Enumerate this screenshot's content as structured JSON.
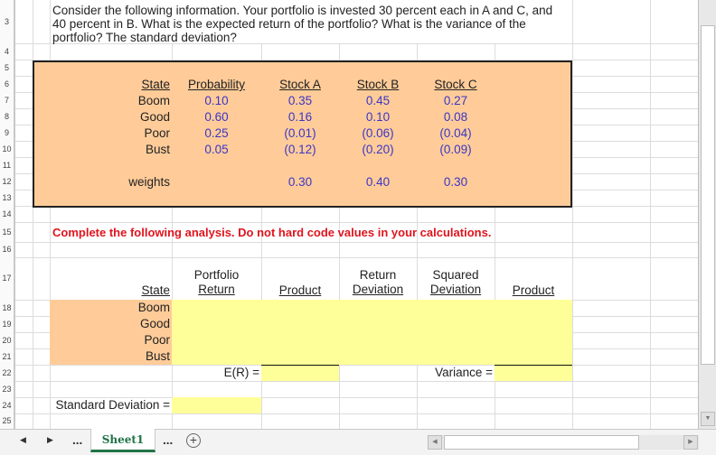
{
  "prompt": {
    "line1": "Consider the following information. Your portfolio is invested 30 percent each in A and C, and",
    "line2": "40 percent in B. What is the expected return of the portfolio? What is the variance of the",
    "line3": "portfolio? The standard deviation?"
  },
  "row_numbers": [
    "3",
    "4",
    "5",
    "6",
    "7",
    "8",
    "9",
    "10",
    "11",
    "12",
    "13",
    "14",
    "15",
    "16",
    "17",
    "18",
    "19",
    "20",
    "21",
    "22",
    "23",
    "24",
    "25"
  ],
  "info_table": {
    "headers": [
      "State",
      "Probability",
      "Stock A",
      "Stock B",
      "Stock C"
    ],
    "rows": [
      {
        "state": "Boom",
        "prob": "0.10",
        "a": "0.35",
        "b": "0.45",
        "c": "0.27"
      },
      {
        "state": "Good",
        "prob": "0.60",
        "a": "0.16",
        "b": "0.10",
        "c": "0.08"
      },
      {
        "state": "Poor",
        "prob": "0.25",
        "a": "(0.01)",
        "b": "(0.06)",
        "c": "(0.04)"
      },
      {
        "state": "Bust",
        "prob": "0.05",
        "a": "(0.12)",
        "b": "(0.20)",
        "c": "(0.09)"
      }
    ],
    "weights_label": "weights",
    "weights": {
      "a": "0.30",
      "b": "0.40",
      "c": "0.30"
    }
  },
  "instruction": "Complete the following analysis. Do not hard code values in your calculations.",
  "analysis": {
    "headers": {
      "state": "State",
      "portfolio_line1": "Portfolio",
      "portfolio_line2": "Return",
      "product1": "Product",
      "retdev_line1": "Return",
      "retdev_line2": "Deviation",
      "sqdev_line1": "Squared",
      "sqdev_line2": "Deviation",
      "product2": "Product"
    },
    "states": [
      "Boom",
      "Good",
      "Poor",
      "Bust"
    ],
    "er_label": "E(R) =",
    "variance_label": "Variance =",
    "stdev_label": "Standard Deviation ="
  },
  "tabs": {
    "prev": "◀",
    "next": "▶",
    "more_left": "...",
    "active": "Sheet1",
    "more_right": "...",
    "add": "+"
  },
  "colors": {
    "input_orange": "#ffcc99",
    "answer_yellow": "#ffff99",
    "value_blue": "#3b35c6",
    "instruction_red": "#e0141e",
    "tab_green": "#217346"
  }
}
